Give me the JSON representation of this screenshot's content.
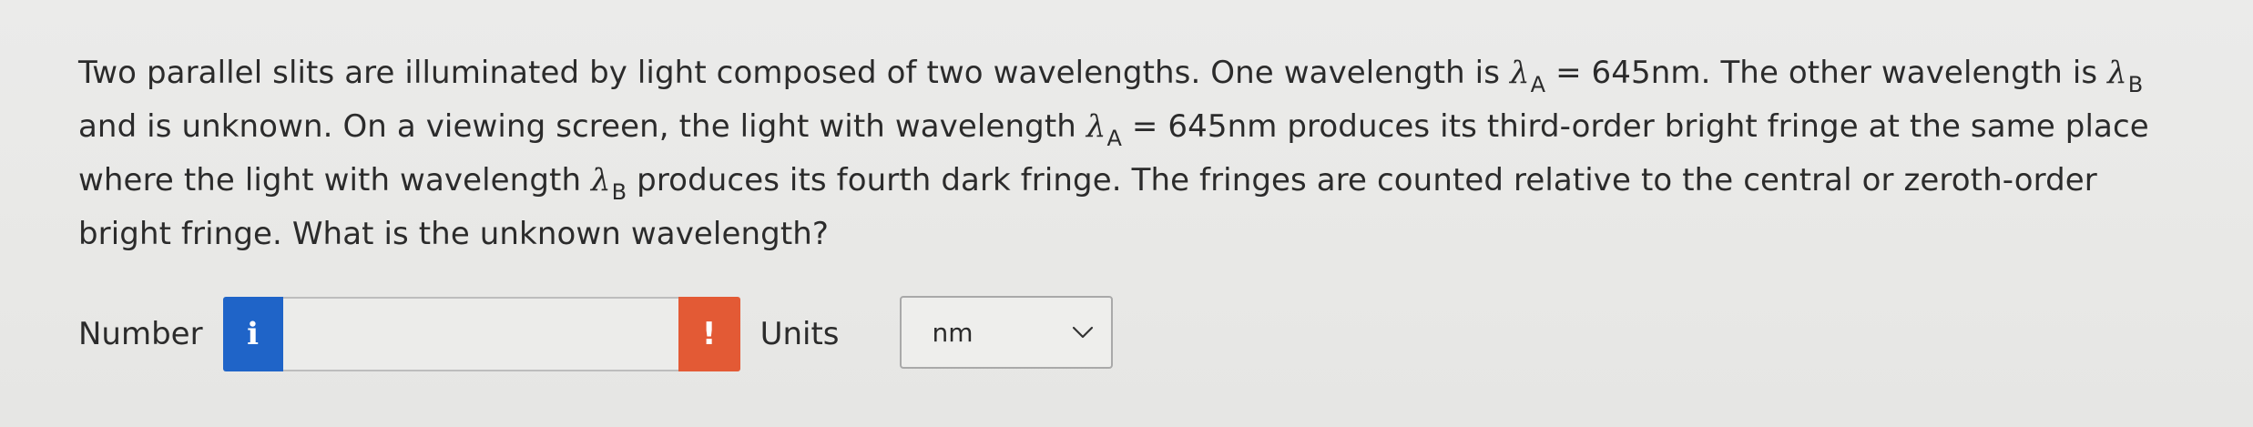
{
  "question": {
    "line1": {
      "before": "Two parallel slits are illuminated by light composed of two wavelengths. One wavelength is ",
      "lambda_a": "λ",
      "sub_a": "A",
      "value_a": " = 645nm. The other wavelength is ",
      "lambda_b": "λ",
      "sub_b": "B"
    },
    "line2": {
      "before": "and is unknown. On a viewing screen, the light with wavelength ",
      "lambda_a": "λ",
      "sub_a": "A",
      "after": " = 645nm produces its third-order bright fringe at the same place"
    },
    "line3": {
      "before": "where the light with wavelength ",
      "lambda_b": "λ",
      "sub_b": "B",
      "after": " produces its fourth dark fringe. The fringes are counted relative to the central or zeroth-order"
    },
    "line4": "bright fringe. What is the unknown wavelength?"
  },
  "answer": {
    "number_label": "Number",
    "info_icon": "i",
    "input_value": "",
    "warning_icon": "!",
    "units_label": "Units",
    "units_selected": "nm"
  },
  "colors": {
    "info_button": "#1f64c8",
    "warning_button": "#e35a35",
    "background": "#ebebea",
    "text": "#2b2b2b"
  },
  "icons": {
    "info": "info-icon",
    "warning": "exclamation-icon",
    "dropdown": "chevron-down-icon"
  }
}
